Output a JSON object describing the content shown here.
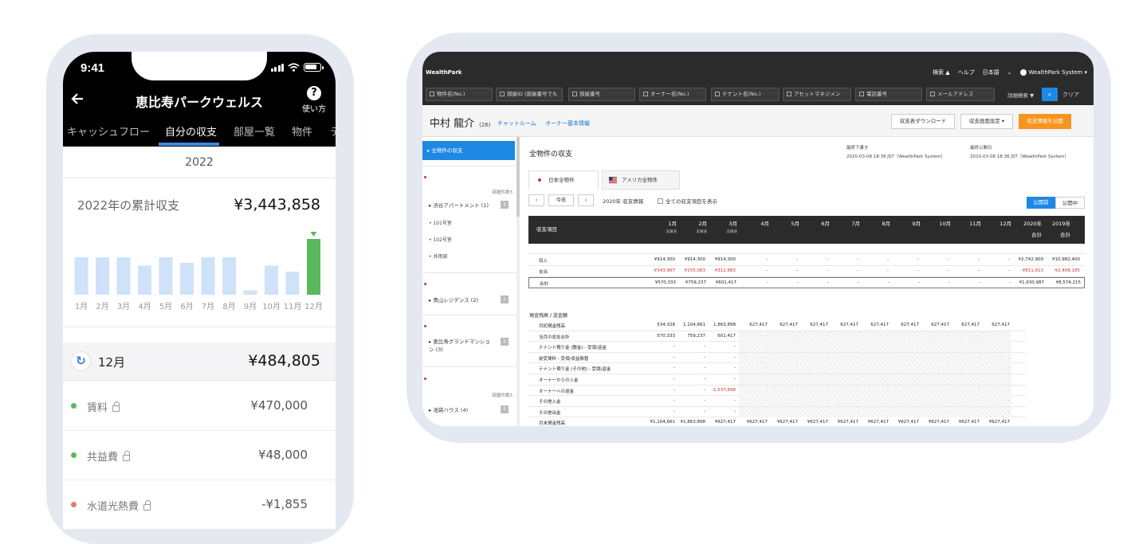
{
  "phone": {
    "status_time": "9:41",
    "back_icon": "arrow-left-icon",
    "title": "恵比寿パークウェルス",
    "help_label": "使い方",
    "tabs": [
      "キャッシュフロー",
      "自分の収支",
      "部屋一覧",
      "物件",
      "テ"
    ],
    "active_tab": "自分の収支",
    "year": "2022",
    "summary_label": "2022年の累計収支",
    "summary_value": "¥3,443,858",
    "chart_data": {
      "type": "bar",
      "categories": [
        "1月",
        "2月",
        "3月",
        "4月",
        "5月",
        "6月",
        "7月",
        "8月",
        "9月",
        "10月",
        "11月",
        "12月"
      ],
      "values": [
        470,
        470,
        470,
        365,
        470,
        400,
        470,
        470,
        55,
        365,
        290,
        700
      ],
      "highlight_index": 11,
      "colors": {
        "normal": "#cfe2f9",
        "highlight": "#5cb85c",
        "marker": "#5cb85c"
      }
    },
    "month_label": "12月",
    "month_value": "¥484,805",
    "items": [
      {
        "label": "賃料",
        "value": "¥470,000",
        "dot_color": "#5cb85c"
      },
      {
        "label": "共益費",
        "value": "¥48,000",
        "dot_color": "#5cb85c"
      },
      {
        "label": "水道光熱費",
        "value": "-¥1,855",
        "dot_color": "#d9826a"
      }
    ]
  },
  "tablet": {
    "logo": "WealthPark",
    "nav": {
      "search": "検索 ▲",
      "help": "ヘルプ",
      "language": "日本語",
      "user": "WealthPark System"
    },
    "filters": [
      "物件名(No.)",
      "部屋ID (部屋番号でも",
      "部屋番号",
      "オーナー名(No.)",
      "テナント名(No.)",
      "アセットマネジメン",
      "電話番号",
      "メールアドレス"
    ],
    "detail_search": "詳細検索 ▼",
    "clear": "クリア",
    "owner_name": "中村 龍介",
    "owner_id": "(26)",
    "links": [
      "チャットルーム",
      "オーナー基本情報"
    ],
    "buttons": {
      "download": "収支表ダウンロード",
      "display_settings": "収支画面設定 ▾",
      "publish": "収支情報を公開"
    },
    "sidebar": {
      "active": "全物件の収支",
      "properties": [
        {
          "name": "渋谷アパートメント (1)",
          "badge": "3",
          "rooms": [
            "101号室",
            "102号室",
            "共用部"
          ],
          "note": "部屋件数3"
        },
        {
          "name": "青山レジデンス (2)",
          "badge": "1"
        },
        {
          "name": "恵比寿グランドマンション (3)",
          "badge": "1"
        },
        {
          "name": "池袋ハウス (4)",
          "badge": "3",
          "note": "部屋件数3"
        }
      ]
    },
    "main": {
      "title": "全物件の収支",
      "last_update_label": "最終下書き",
      "last_update_value": "2020-03-08 18:36 JST（WealthPark System）",
      "last_publish_label": "最終公開日",
      "last_publish_value": "2020-03-08 18:36 JST（WealthPark System）",
      "country_tabs": [
        "日本全物件",
        "アメリカ全物件"
      ],
      "today": "今年",
      "period": "2020年 収支情報",
      "show_all": "全ての収支項目を表示",
      "pub_before": "公開前",
      "pub_during": "公開中",
      "table_headers": [
        "収支項目",
        "1月",
        "2月",
        "3月",
        "4月",
        "5月",
        "6月",
        "7月",
        "8月",
        "9月",
        "10月",
        "11月",
        "12月",
        "2020年 合計",
        "2019年 合計"
      ],
      "header_sub": "実績値",
      "summary_rows": [
        {
          "label": "収入",
          "values": [
            "¥914,300",
            "¥914,300",
            "¥914,300"
          ],
          "total2020": "¥2,742,900",
          "total2019": "¥10,982,400"
        },
        {
          "label": "支出",
          "values": [
            "-¥343,967",
            "-¥155,063",
            "-¥312,883"
          ],
          "total2020": "-¥811,913",
          "total2019": "-¥2,408,185"
        },
        {
          "label": "合計",
          "values": [
            "¥570,333",
            "¥759,237",
            "¥601,417"
          ],
          "total2020": "¥1,930,987",
          "total2019": "¥8,574,215"
        }
      ],
      "cash_section": "現金残高 / 送金額",
      "cash_rows": [
        {
          "label": "月初現金残高",
          "values": [
            "534,328",
            "1,104,661",
            "1,863,898",
            "627,417",
            "627,417",
            "627,417",
            "627,417",
            "627,417",
            "627,417",
            "627,417",
            "627,417",
            "627,417"
          ]
        },
        {
          "label": "当月の収支合計",
          "values": [
            "570,333",
            "759,237",
            "601,417"
          ]
        },
        {
          "label": "テナント預り金 (敷金) - 受領/返金",
          "values": [
            "-",
            "-",
            "-"
          ]
        },
        {
          "label": "前受賃料 - 受領/収益振替",
          "values": [
            "-",
            "-",
            "-"
          ]
        },
        {
          "label": "テナント預り金 (その他) - 受領/返金",
          "values": [
            "-",
            "-",
            "-"
          ]
        },
        {
          "label": "オーナーからの入金",
          "values": [
            "-",
            "-",
            "-"
          ]
        },
        {
          "label": "オーナーへの送金",
          "values": [
            "-",
            "-",
            "-1,537,898"
          ]
        },
        {
          "label": "その他入金",
          "values": [
            "-",
            "-",
            "-"
          ]
        },
        {
          "label": "その他出金",
          "values": [
            "-",
            "-",
            "-"
          ]
        },
        {
          "label": "月末現金残高",
          "values": [
            "¥1,104,661",
            "¥1,863,898",
            "¥627,417",
            "¥627,417",
            "¥627,417",
            "¥627,417",
            "¥627,417",
            "¥627,417",
            "¥627,417",
            "¥627,417",
            "¥627,417",
            "¥627,417"
          ]
        }
      ]
    }
  }
}
